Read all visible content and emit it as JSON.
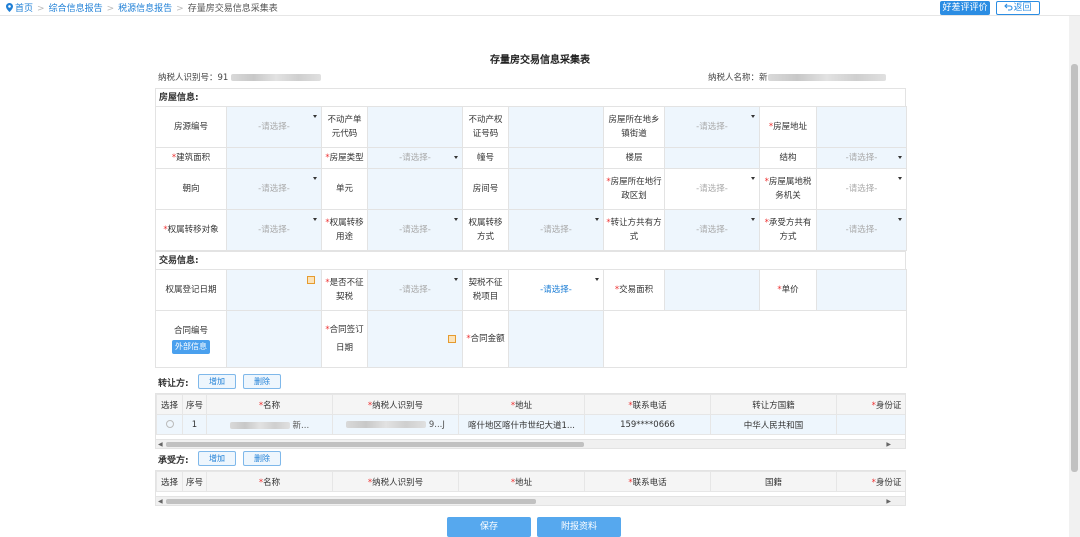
{
  "breadcrumb": {
    "home": "首页",
    "items": [
      "综合信息报告",
      "税源信息报告"
    ],
    "current": "存量房交易信息采集表"
  },
  "header": {
    "rate_button": "好差评评价",
    "back_button": "返回"
  },
  "form_title": "存量房交易信息采集表",
  "taxpayer": {
    "id_label": "纳税人识别号：",
    "id_value_visible": "91",
    "name_label": "纳税人名称：",
    "name_value_visible": "新"
  },
  "house": {
    "section": "房屋信息:",
    "placeholder": "-请选择-",
    "r1": [
      "房源编号",
      "不动产单元代码",
      "不动产权证号码",
      "房屋所在地乡镇街道",
      "房屋地址"
    ],
    "r2": [
      "建筑面积",
      "房屋类型",
      "幢号",
      "楼层",
      "结构"
    ],
    "r3": [
      "朝向",
      "单元",
      "房间号",
      "房屋所在地行政区划",
      "房屋属地税务机关"
    ],
    "r4": [
      "权属转移对象",
      "权属转移用途",
      "权属转移方式",
      "转让方共有方式",
      "承受方共有方式"
    ]
  },
  "trade": {
    "section": "交易信息:",
    "placeholder": "-请选择-",
    "r1": [
      "权属登记日期",
      "是否不征契税",
      "契税不征税项目",
      "交易面积",
      "单价"
    ],
    "r1_select_blue": "-请选择-",
    "contract_no": "合同编号",
    "ext_info": "外部信息",
    "sign_date": "合同签订日期",
    "amount": "合同金额"
  },
  "transferor": {
    "label": "转让方:",
    "add": "增加",
    "del": "删除",
    "columns": [
      "选择",
      "序号",
      "名称",
      "纳税人识别号",
      "地址",
      "联系电话",
      "转让方国籍",
      "身份证"
    ],
    "rows": [
      {
        "no": "1",
        "name": "新...",
        "taxid": "9...J",
        "address": "喀什地区喀什市世纪大道1...",
        "phone": "159****0666",
        "nationality": "中华人民共和国",
        "idcard": ""
      }
    ]
  },
  "transferee": {
    "label": "承受方:",
    "add": "增加",
    "del": "删除",
    "columns": [
      "选择",
      "序号",
      "名称",
      "纳税人识别号",
      "地址",
      "联系电话",
      "国籍",
      "身份证"
    ]
  },
  "buttons": {
    "save": "保存",
    "attach": "附报资料"
  },
  "colors": {
    "accent": "#2b8de3",
    "required": "#e33333",
    "input_bg": "#eef6fd"
  }
}
